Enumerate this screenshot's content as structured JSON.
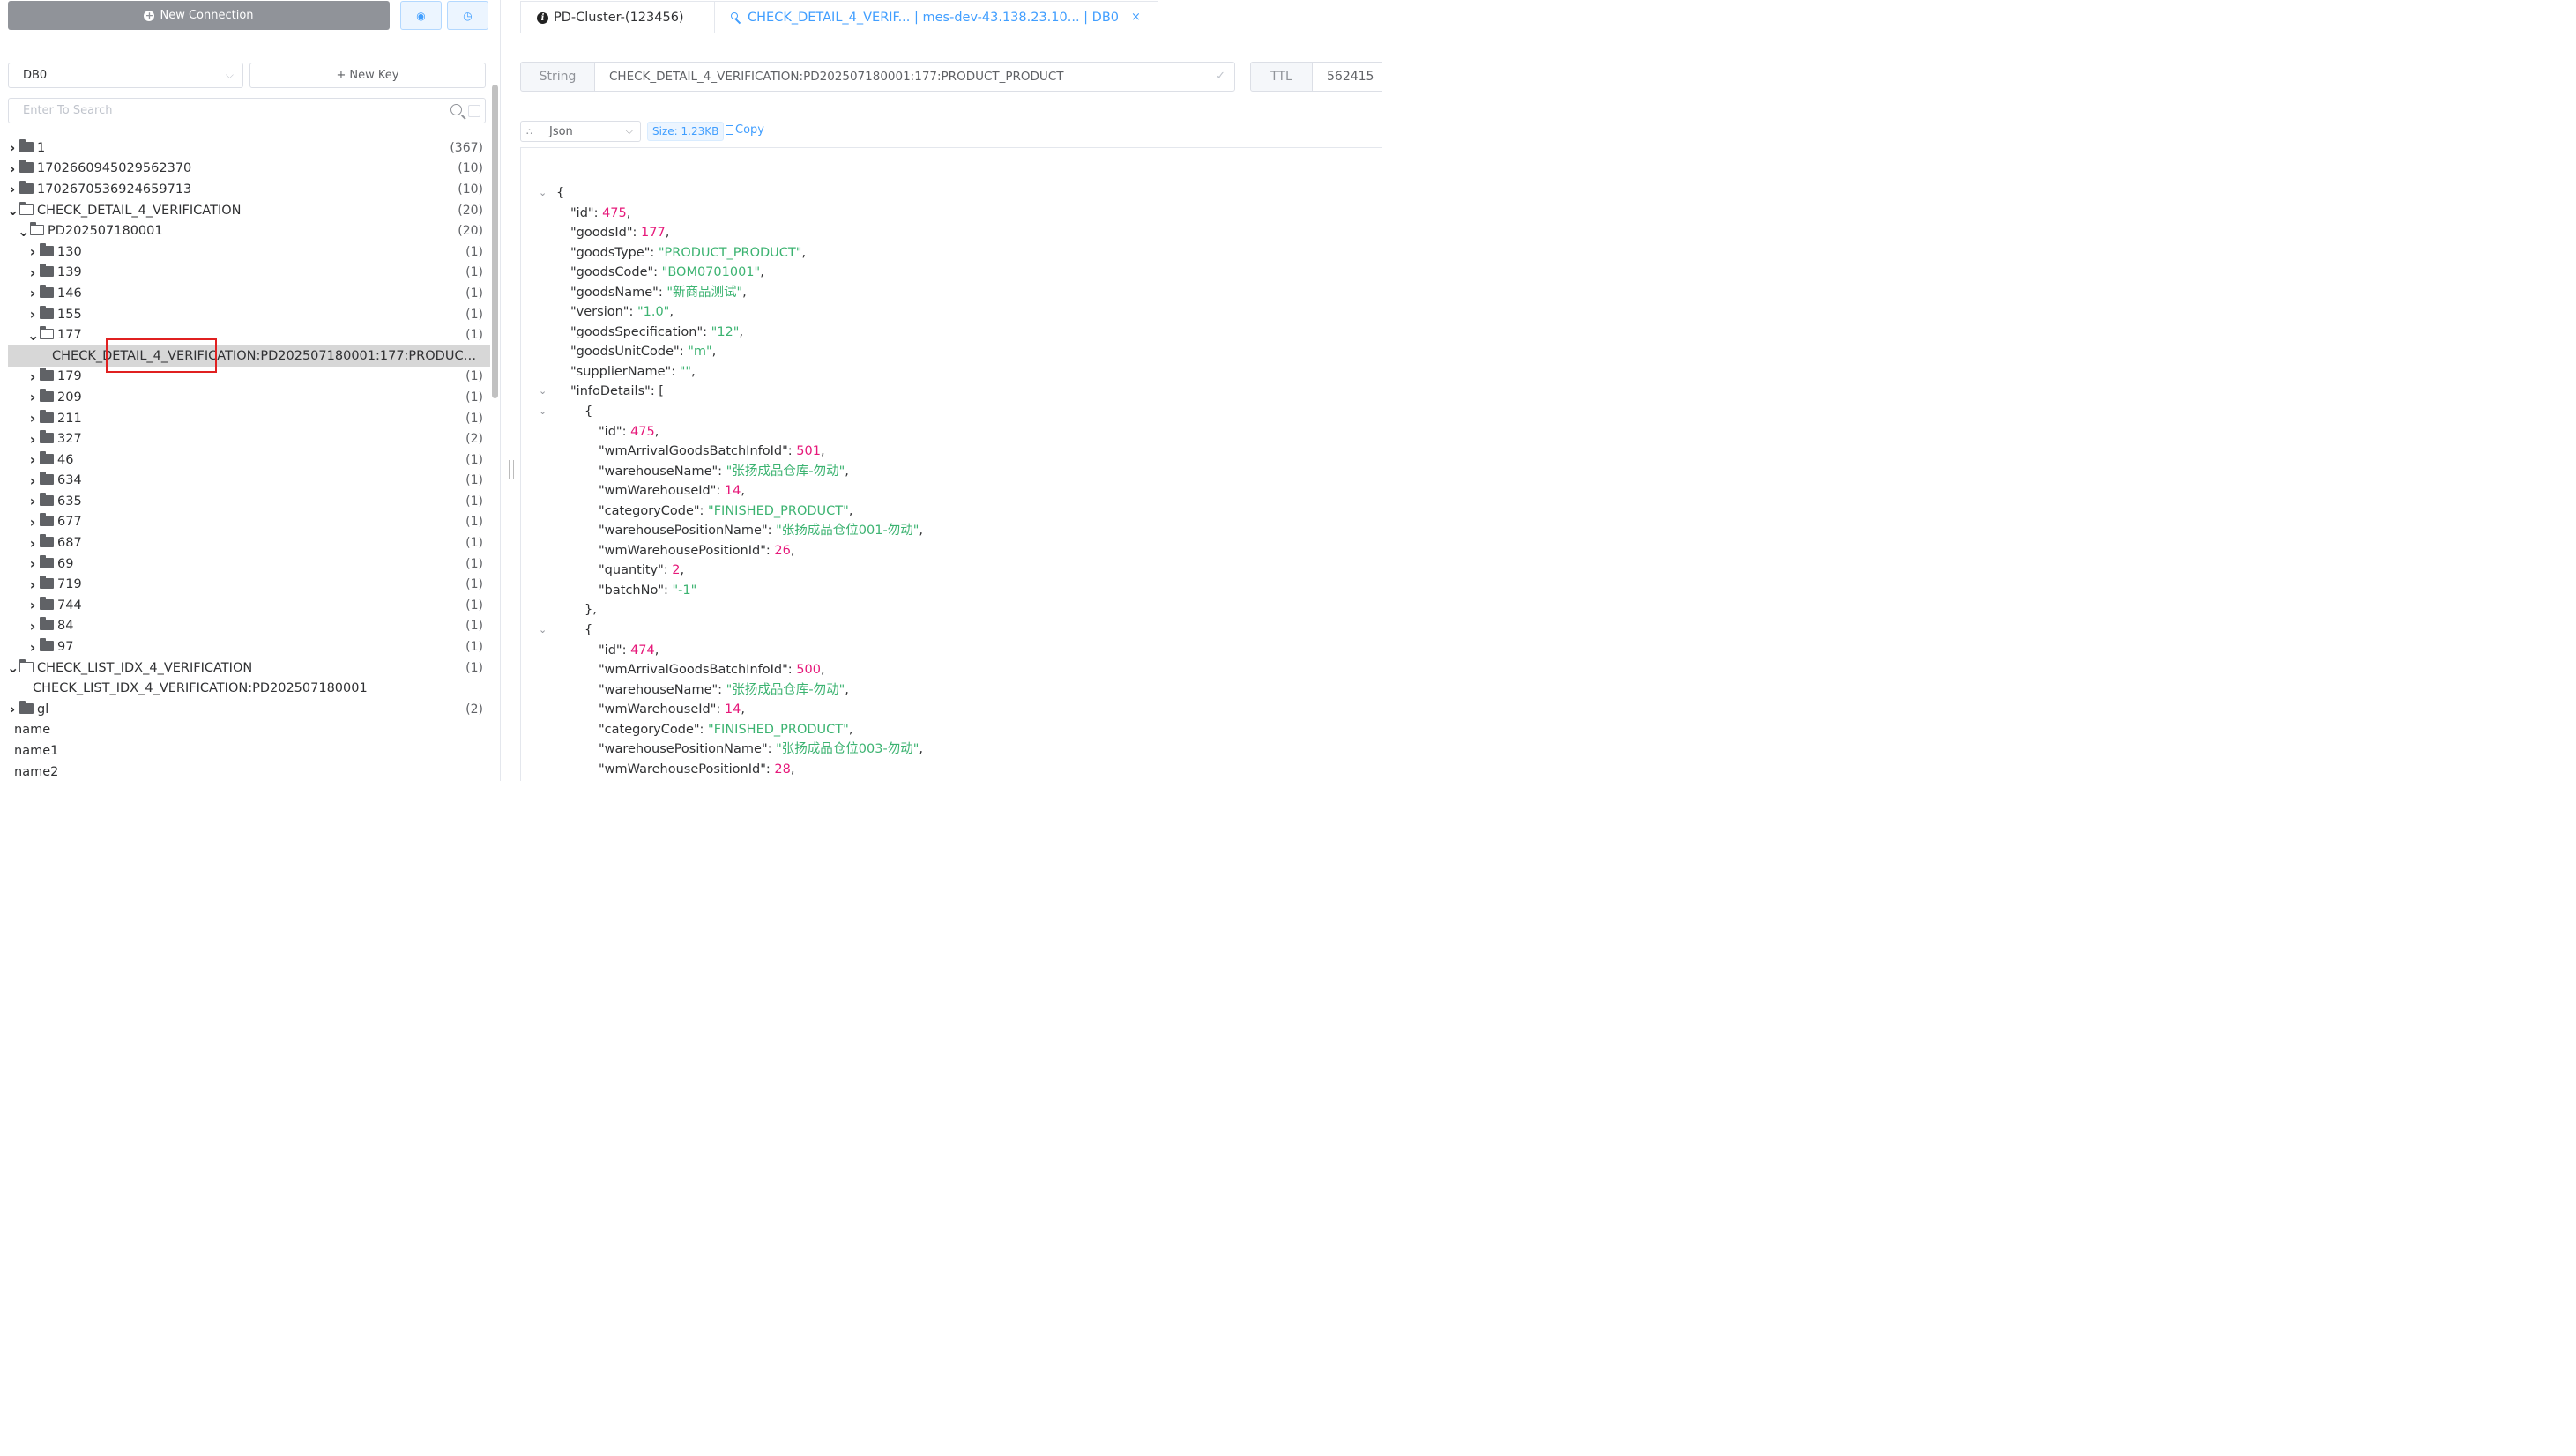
{
  "left": {
    "new_connection": "New Connection",
    "db_select": "DB0",
    "new_key": "New Key",
    "search_placeholder": "Enter To Search",
    "tree": [
      {
        "label": "1",
        "count": "(367)",
        "level": 0,
        "type": "folder",
        "expanded": false
      },
      {
        "label": "1702660945029562370",
        "count": "(10)",
        "level": 0,
        "type": "folder",
        "expanded": false
      },
      {
        "label": "1702670536924659713",
        "count": "(10)",
        "level": 0,
        "type": "folder",
        "expanded": false
      },
      {
        "label": "CHECK_DETAIL_4_VERIFICATION",
        "count": "(20)",
        "level": 0,
        "type": "folder",
        "expanded": true
      },
      {
        "label": "PD202507180001",
        "count": "(20)",
        "level": 1,
        "type": "folder",
        "expanded": true
      },
      {
        "label": "130",
        "count": "(1)",
        "level": 2,
        "type": "folder",
        "expanded": false
      },
      {
        "label": "139",
        "count": "(1)",
        "level": 2,
        "type": "folder",
        "expanded": false
      },
      {
        "label": "146",
        "count": "(1)",
        "level": 2,
        "type": "folder",
        "expanded": false
      },
      {
        "label": "155",
        "count": "(1)",
        "level": 2,
        "type": "folder",
        "expanded": false
      },
      {
        "label": "177",
        "count": "(1)",
        "level": 2,
        "type": "folder",
        "expanded": true
      },
      {
        "label": "CHECK_DETAIL_4_VERIFICATION:PD202507180001:177:PRODUCT_PRODUCT",
        "count": "",
        "level": 3,
        "type": "key",
        "selected": true
      },
      {
        "label": "179",
        "count": "(1)",
        "level": 2,
        "type": "folder",
        "expanded": false
      },
      {
        "label": "209",
        "count": "(1)",
        "level": 2,
        "type": "folder",
        "expanded": false
      },
      {
        "label": "211",
        "count": "(1)",
        "level": 2,
        "type": "folder",
        "expanded": false
      },
      {
        "label": "327",
        "count": "(2)",
        "level": 2,
        "type": "folder",
        "expanded": false
      },
      {
        "label": "46",
        "count": "(1)",
        "level": 2,
        "type": "folder",
        "expanded": false
      },
      {
        "label": "634",
        "count": "(1)",
        "level": 2,
        "type": "folder",
        "expanded": false
      },
      {
        "label": "635",
        "count": "(1)",
        "level": 2,
        "type": "folder",
        "expanded": false
      },
      {
        "label": "677",
        "count": "(1)",
        "level": 2,
        "type": "folder",
        "expanded": false
      },
      {
        "label": "687",
        "count": "(1)",
        "level": 2,
        "type": "folder",
        "expanded": false
      },
      {
        "label": "69",
        "count": "(1)",
        "level": 2,
        "type": "folder",
        "expanded": false
      },
      {
        "label": "719",
        "count": "(1)",
        "level": 2,
        "type": "folder",
        "expanded": false
      },
      {
        "label": "744",
        "count": "(1)",
        "level": 2,
        "type": "folder",
        "expanded": false
      },
      {
        "label": "84",
        "count": "(1)",
        "level": 2,
        "type": "folder",
        "expanded": false
      },
      {
        "label": "97",
        "count": "(1)",
        "level": 2,
        "type": "folder",
        "expanded": false
      },
      {
        "label": "CHECK_LIST_IDX_4_VERIFICATION",
        "count": "(1)",
        "level": 0,
        "type": "folder",
        "expanded": true
      },
      {
        "label": "CHECK_LIST_IDX_4_VERIFICATION:PD202507180001",
        "count": "",
        "level": 1,
        "type": "key"
      },
      {
        "label": "gl",
        "count": "(2)",
        "level": 0,
        "type": "folder",
        "expanded": false
      },
      {
        "label": "name",
        "count": "",
        "level": 0,
        "type": "key"
      },
      {
        "label": "name1",
        "count": "",
        "level": 0,
        "type": "key"
      },
      {
        "label": "name2",
        "count": "",
        "level": 0,
        "type": "key"
      }
    ]
  },
  "right": {
    "tabs": [
      {
        "label": "PD-Cluster-(123456)"
      },
      {
        "label": "CHECK_DETAIL_4_VERIF... | mes-dev-43.138.23.10... | DB0"
      }
    ],
    "key_type": "String",
    "key_name": "CHECK_DETAIL_4_VERIFICATION:PD202507180001:177:PRODUCT_PRODUCT",
    "ttl_label": "TTL",
    "ttl_value": "562415",
    "format": "Json",
    "size": "Size: 1.23KB",
    "copy": "Copy",
    "json_lines": [
      {
        "indent": 0,
        "fold": true,
        "text": "{"
      },
      {
        "indent": 1,
        "key": "id",
        "val": "475",
        "vt": "n",
        "tail": ","
      },
      {
        "indent": 1,
        "key": "goodsId",
        "val": "177",
        "vt": "n",
        "tail": ","
      },
      {
        "indent": 1,
        "key": "goodsType",
        "val": "\"PRODUCT_PRODUCT\"",
        "vt": "s",
        "tail": ","
      },
      {
        "indent": 1,
        "key": "goodsCode",
        "val": "\"BOM0701001\"",
        "vt": "s",
        "tail": ","
      },
      {
        "indent": 1,
        "key": "goodsName",
        "val": "\"新商品测试\"",
        "vt": "s",
        "tail": ","
      },
      {
        "indent": 1,
        "key": "version",
        "val": "\"1.0\"",
        "vt": "s",
        "tail": ","
      },
      {
        "indent": 1,
        "key": "goodsSpecification",
        "val": "\"12\"",
        "vt": "s",
        "tail": ","
      },
      {
        "indent": 1,
        "key": "goodsUnitCode",
        "val": "\"m\"",
        "vt": "s",
        "tail": ","
      },
      {
        "indent": 1,
        "key": "supplierName",
        "val": "\"\"",
        "vt": "s",
        "tail": ","
      },
      {
        "indent": 1,
        "fold": true,
        "key": "infoDetails",
        "raw": ": ["
      },
      {
        "indent": 2,
        "fold": true,
        "text": "{"
      },
      {
        "indent": 3,
        "key": "id",
        "val": "475",
        "vt": "n",
        "tail": ","
      },
      {
        "indent": 3,
        "key": "wmArrivalGoodsBatchInfoId",
        "val": "501",
        "vt": "n",
        "tail": ","
      },
      {
        "indent": 3,
        "key": "warehouseName",
        "val": "\"张扬成品仓库-勿动\"",
        "vt": "s",
        "tail": ","
      },
      {
        "indent": 3,
        "key": "wmWarehouseId",
        "val": "14",
        "vt": "n",
        "tail": ","
      },
      {
        "indent": 3,
        "key": "categoryCode",
        "val": "\"FINISHED_PRODUCT\"",
        "vt": "s",
        "tail": ","
      },
      {
        "indent": 3,
        "key": "warehousePositionName",
        "val": "\"张扬成品仓位001-勿动\"",
        "vt": "s",
        "tail": ","
      },
      {
        "indent": 3,
        "key": "wmWarehousePositionId",
        "val": "26",
        "vt": "n",
        "tail": ","
      },
      {
        "indent": 3,
        "key": "quantity",
        "val": "2",
        "vt": "n",
        "tail": ","
      },
      {
        "indent": 3,
        "key": "batchNo",
        "val": "\"-1\"",
        "vt": "s",
        "tail": ""
      },
      {
        "indent": 2,
        "text": "},"
      },
      {
        "indent": 2,
        "fold": true,
        "text": "{"
      },
      {
        "indent": 3,
        "key": "id",
        "val": "474",
        "vt": "n",
        "tail": ","
      },
      {
        "indent": 3,
        "key": "wmArrivalGoodsBatchInfoId",
        "val": "500",
        "vt": "n",
        "tail": ","
      },
      {
        "indent": 3,
        "key": "warehouseName",
        "val": "\"张扬成品仓库-勿动\"",
        "vt": "s",
        "tail": ","
      },
      {
        "indent": 3,
        "key": "wmWarehouseId",
        "val": "14",
        "vt": "n",
        "tail": ","
      },
      {
        "indent": 3,
        "key": "categoryCode",
        "val": "\"FINISHED_PRODUCT\"",
        "vt": "s",
        "tail": ","
      },
      {
        "indent": 3,
        "key": "warehousePositionName",
        "val": "\"张扬成品仓位003-勿动\"",
        "vt": "s",
        "tail": ","
      },
      {
        "indent": 3,
        "key": "wmWarehousePositionId",
        "val": "28",
        "vt": "n",
        "tail": ","
      }
    ]
  }
}
